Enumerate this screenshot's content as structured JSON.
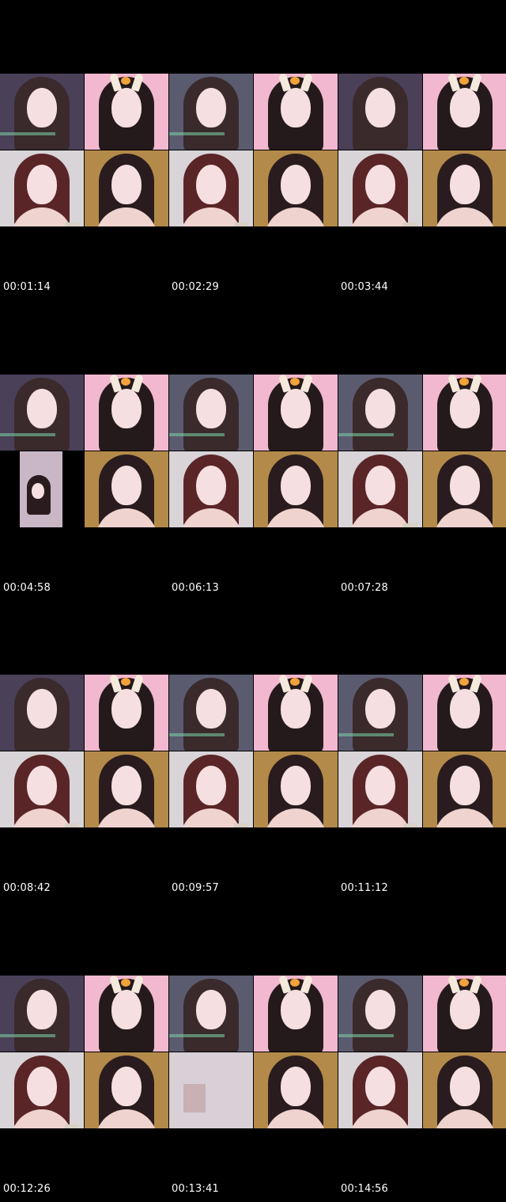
{
  "sheet": {
    "rows": [
      {
        "timestamps": [
          "00:01:14",
          "00:02:29",
          "00:03:44"
        ]
      },
      {
        "timestamps": [
          "00:04:58",
          "00:06:13",
          "00:07:28"
        ]
      },
      {
        "timestamps": [
          "00:08:42",
          "00:09:57",
          "00:11:12"
        ]
      },
      {
        "timestamps": [
          "00:12:26",
          "00:13:41",
          "00:14:56"
        ]
      }
    ]
  },
  "colors": {
    "background": "#000000",
    "timestamp_text": "#ffffff",
    "pink_backdrop": "#f2b8cf",
    "gold_backdrop": "#b48a4a",
    "dark_hair": "#2a1c1e",
    "auburn_hair": "#5a2526",
    "grey_room": "#5b5b66"
  }
}
